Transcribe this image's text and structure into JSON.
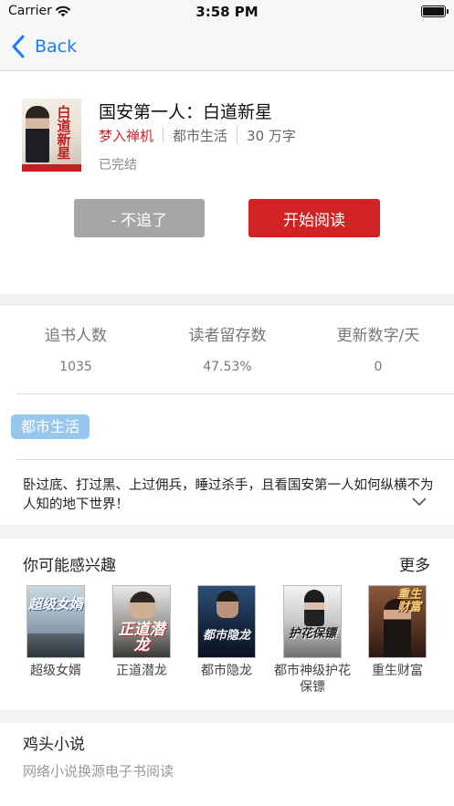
{
  "status_bar": {
    "carrier": "Carrier",
    "time": "3:58 PM"
  },
  "nav": {
    "back_label": "Back"
  },
  "book": {
    "title": "国安第一人：白道新星",
    "author": "梦入禅机",
    "category": "都市生活",
    "word_count": "30 万字",
    "status": "已完结",
    "cover_title": "白道新星"
  },
  "actions": {
    "unfollow_label": "- 不追了",
    "read_label": "开始阅读"
  },
  "stats": [
    {
      "label": "追书人数",
      "value": "1035"
    },
    {
      "label": "读者留存数",
      "value": "47.53%"
    },
    {
      "label": "更新数字/天",
      "value": "0"
    }
  ],
  "tag": "都市生活",
  "synopsis": "卧过底、打过黑、上过佣兵，睡过杀手，且看国安第一人如何纵横不为人知的地下世界！",
  "recommendations": {
    "title": "你可能感兴趣",
    "more_label": "更多",
    "items": [
      {
        "label": "超级女婿",
        "cover_text": "超级女婿"
      },
      {
        "label": "正道潜龙",
        "cover_text": "正道潜龙"
      },
      {
        "label": "都市隐龙",
        "cover_text": "都市隐龙"
      },
      {
        "label": "都市神级护花保镖",
        "cover_text": "护花保镖"
      },
      {
        "label": "重生财富",
        "cover_text": "重生财富"
      }
    ]
  },
  "footer": {
    "title": "鸡头小说",
    "subtitle": "网络小说换源电子书阅读"
  },
  "colors": {
    "accent_red": "#d12323",
    "author_red": "#c0282b",
    "ios_blue": "#1a7cf5",
    "tag_blue": "#98c7ee",
    "button_gray": "#a6a6a6"
  },
  "icons": [
    "wifi-icon",
    "battery-icon",
    "back-chevron-icon",
    "expand-chevron-icon"
  ]
}
